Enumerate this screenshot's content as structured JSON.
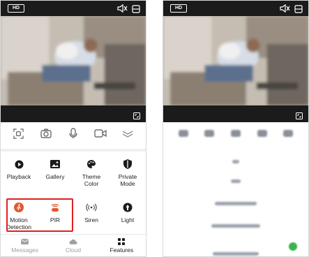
{
  "phone_left": {
    "hd_label": "HD",
    "features": [
      {
        "label": "Playback",
        "icon": "playback-icon"
      },
      {
        "label": "Gallery",
        "icon": "gallery-icon"
      },
      {
        "label": "Theme\nColor",
        "icon": "palette-icon"
      },
      {
        "label": "Private\nMode",
        "icon": "private-mode-icon"
      },
      {
        "label": "Motion\nDetection",
        "icon": "motion-detection-icon",
        "accent": "#e4572e"
      },
      {
        "label": "PIR",
        "icon": "pir-icon",
        "accent": "#e4572e"
      },
      {
        "label": "Siren",
        "icon": "siren-icon"
      },
      {
        "label": "Light",
        "icon": "light-icon"
      }
    ],
    "tabs": [
      {
        "label": "Messages",
        "icon": "messages-icon",
        "active": false
      },
      {
        "label": "Cloud",
        "icon": "cloud-icon",
        "active": false
      },
      {
        "label": "Features",
        "icon": "features-icon",
        "active": true
      }
    ],
    "controls": [
      "screenshot-icon",
      "camera-icon",
      "microphone-icon",
      "record-icon",
      "collapse-icon"
    ]
  },
  "phone_right": {
    "hd_label": "HD"
  },
  "colors": {
    "highlight": "#e02020",
    "accent_red": "#e4572e",
    "toggle_on": "#3cb34a",
    "bar_dark": "#1b1b1b"
  }
}
